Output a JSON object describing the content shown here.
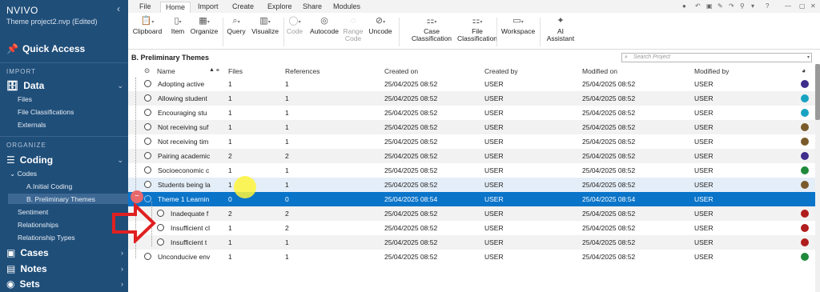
{
  "app": {
    "brand": "NVIVO",
    "project": "Theme project2.nvp (Edited)"
  },
  "sidebar": {
    "quick_access": "Quick Access",
    "import_header": "IMPORT",
    "data": "Data",
    "data_items": [
      "Files",
      "File Classifications",
      "Externals"
    ],
    "organize_header": "ORGANIZE",
    "coding": "Coding",
    "codes": "Codes",
    "code_items": [
      "A.Initial Coding",
      "B. Preliminary Themes"
    ],
    "coding_items": [
      "Sentiment",
      "Relationships",
      "Relationship Types"
    ],
    "cases": "Cases",
    "notes": "Notes",
    "sets": "Sets"
  },
  "tabs": [
    "File",
    "Home",
    "Import",
    "Create",
    "Explore",
    "Share",
    "Modules"
  ],
  "ribbon": {
    "clipboard": "Clipboard",
    "item": "Item",
    "organize": "Organize",
    "query": "Query",
    "visualize": "Visualize",
    "code": "Code",
    "autocode": "Autocode",
    "range_code_1": "Range",
    "range_code_2": "Code",
    "uncode": "Uncode",
    "case_class_1": "Case",
    "case_class_2": "Classification",
    "file_class_1": "File",
    "file_class_2": "Classification",
    "workspace": "Workspace",
    "ai_1": "AI",
    "ai_2": "Assistant"
  },
  "breadcrumb": "B. Preliminary Themes",
  "search": {
    "placeholder": "Search Project"
  },
  "columns": {
    "name": "Name",
    "files": "Files",
    "references": "References",
    "created_on": "Created on",
    "created_by": "Created by",
    "modified_on": "Modified on",
    "modified_by": "Modified by"
  },
  "rows": [
    {
      "name": "Adopting  active",
      "files": "1",
      "refs": "1",
      "created": "25/04/2025 08:52",
      "cby": "USER",
      "modified": "25/04/2025 08:52",
      "mby": "USER",
      "color": "#3f2d8c"
    },
    {
      "name": "Allowing student",
      "files": "1",
      "refs": "1",
      "created": "25/04/2025 08:52",
      "cby": "USER",
      "modified": "25/04/2025 08:52",
      "mby": "USER",
      "color": "#19a3c2"
    },
    {
      "name": "Encouraging stu",
      "files": "1",
      "refs": "1",
      "created": "25/04/2025 08:52",
      "cby": "USER",
      "modified": "25/04/2025 08:52",
      "mby": "USER",
      "color": "#19a3c2"
    },
    {
      "name": "Not receiving suf",
      "files": "1",
      "refs": "1",
      "created": "25/04/2025 08:52",
      "cby": "USER",
      "modified": "25/04/2025 08:52",
      "mby": "USER",
      "color": "#7a5a2a"
    },
    {
      "name": "Not receiving tim",
      "files": "1",
      "refs": "1",
      "created": "25/04/2025 08:52",
      "cby": "USER",
      "modified": "25/04/2025 08:52",
      "mby": "USER",
      "color": "#7a5a2a"
    },
    {
      "name": "Pairing academic",
      "files": "2",
      "refs": "2",
      "created": "25/04/2025 08:52",
      "cby": "USER",
      "modified": "25/04/2025 08:52",
      "mby": "USER",
      "color": "#3f2d8c"
    },
    {
      "name": "Socioeconomic c",
      "files": "1",
      "refs": "1",
      "created": "25/04/2025 08:52",
      "cby": "USER",
      "modified": "25/04/2025 08:52",
      "mby": "USER",
      "color": "#1f8a3a"
    },
    {
      "name": "Students being la",
      "files": "1",
      "refs": "1",
      "created": "25/04/2025 08:52",
      "cby": "USER",
      "modified": "25/04/2025 08:52",
      "mby": "USER",
      "color": "#7a5a2a"
    },
    {
      "name": "Theme 1 Learnin",
      "files": "0",
      "refs": "0",
      "created": "25/04/2025 08:54",
      "cby": "USER",
      "modified": "25/04/2025 08:54",
      "mby": "USER",
      "color": ""
    },
    {
      "name": "Inadequate f",
      "files": "2",
      "refs": "2",
      "created": "25/04/2025 08:52",
      "cby": "USER",
      "modified": "25/04/2025 08:52",
      "mby": "USER",
      "color": "#b01d1d"
    },
    {
      "name": "Insufficient cl",
      "files": "1",
      "refs": "2",
      "created": "25/04/2025 08:52",
      "cby": "USER",
      "modified": "25/04/2025 08:52",
      "mby": "USER",
      "color": "#b01d1d"
    },
    {
      "name": "Insufficient t",
      "files": "1",
      "refs": "1",
      "created": "25/04/2025 08:52",
      "cby": "USER",
      "modified": "25/04/2025 08:52",
      "mby": "USER",
      "color": "#b01d1d"
    },
    {
      "name": "Unconducive env",
      "files": "1",
      "refs": "1",
      "created": "25/04/2025 08:52",
      "cby": "USER",
      "modified": "25/04/2025 08:52",
      "mby": "USER",
      "color": "#1f8a3a"
    }
  ]
}
